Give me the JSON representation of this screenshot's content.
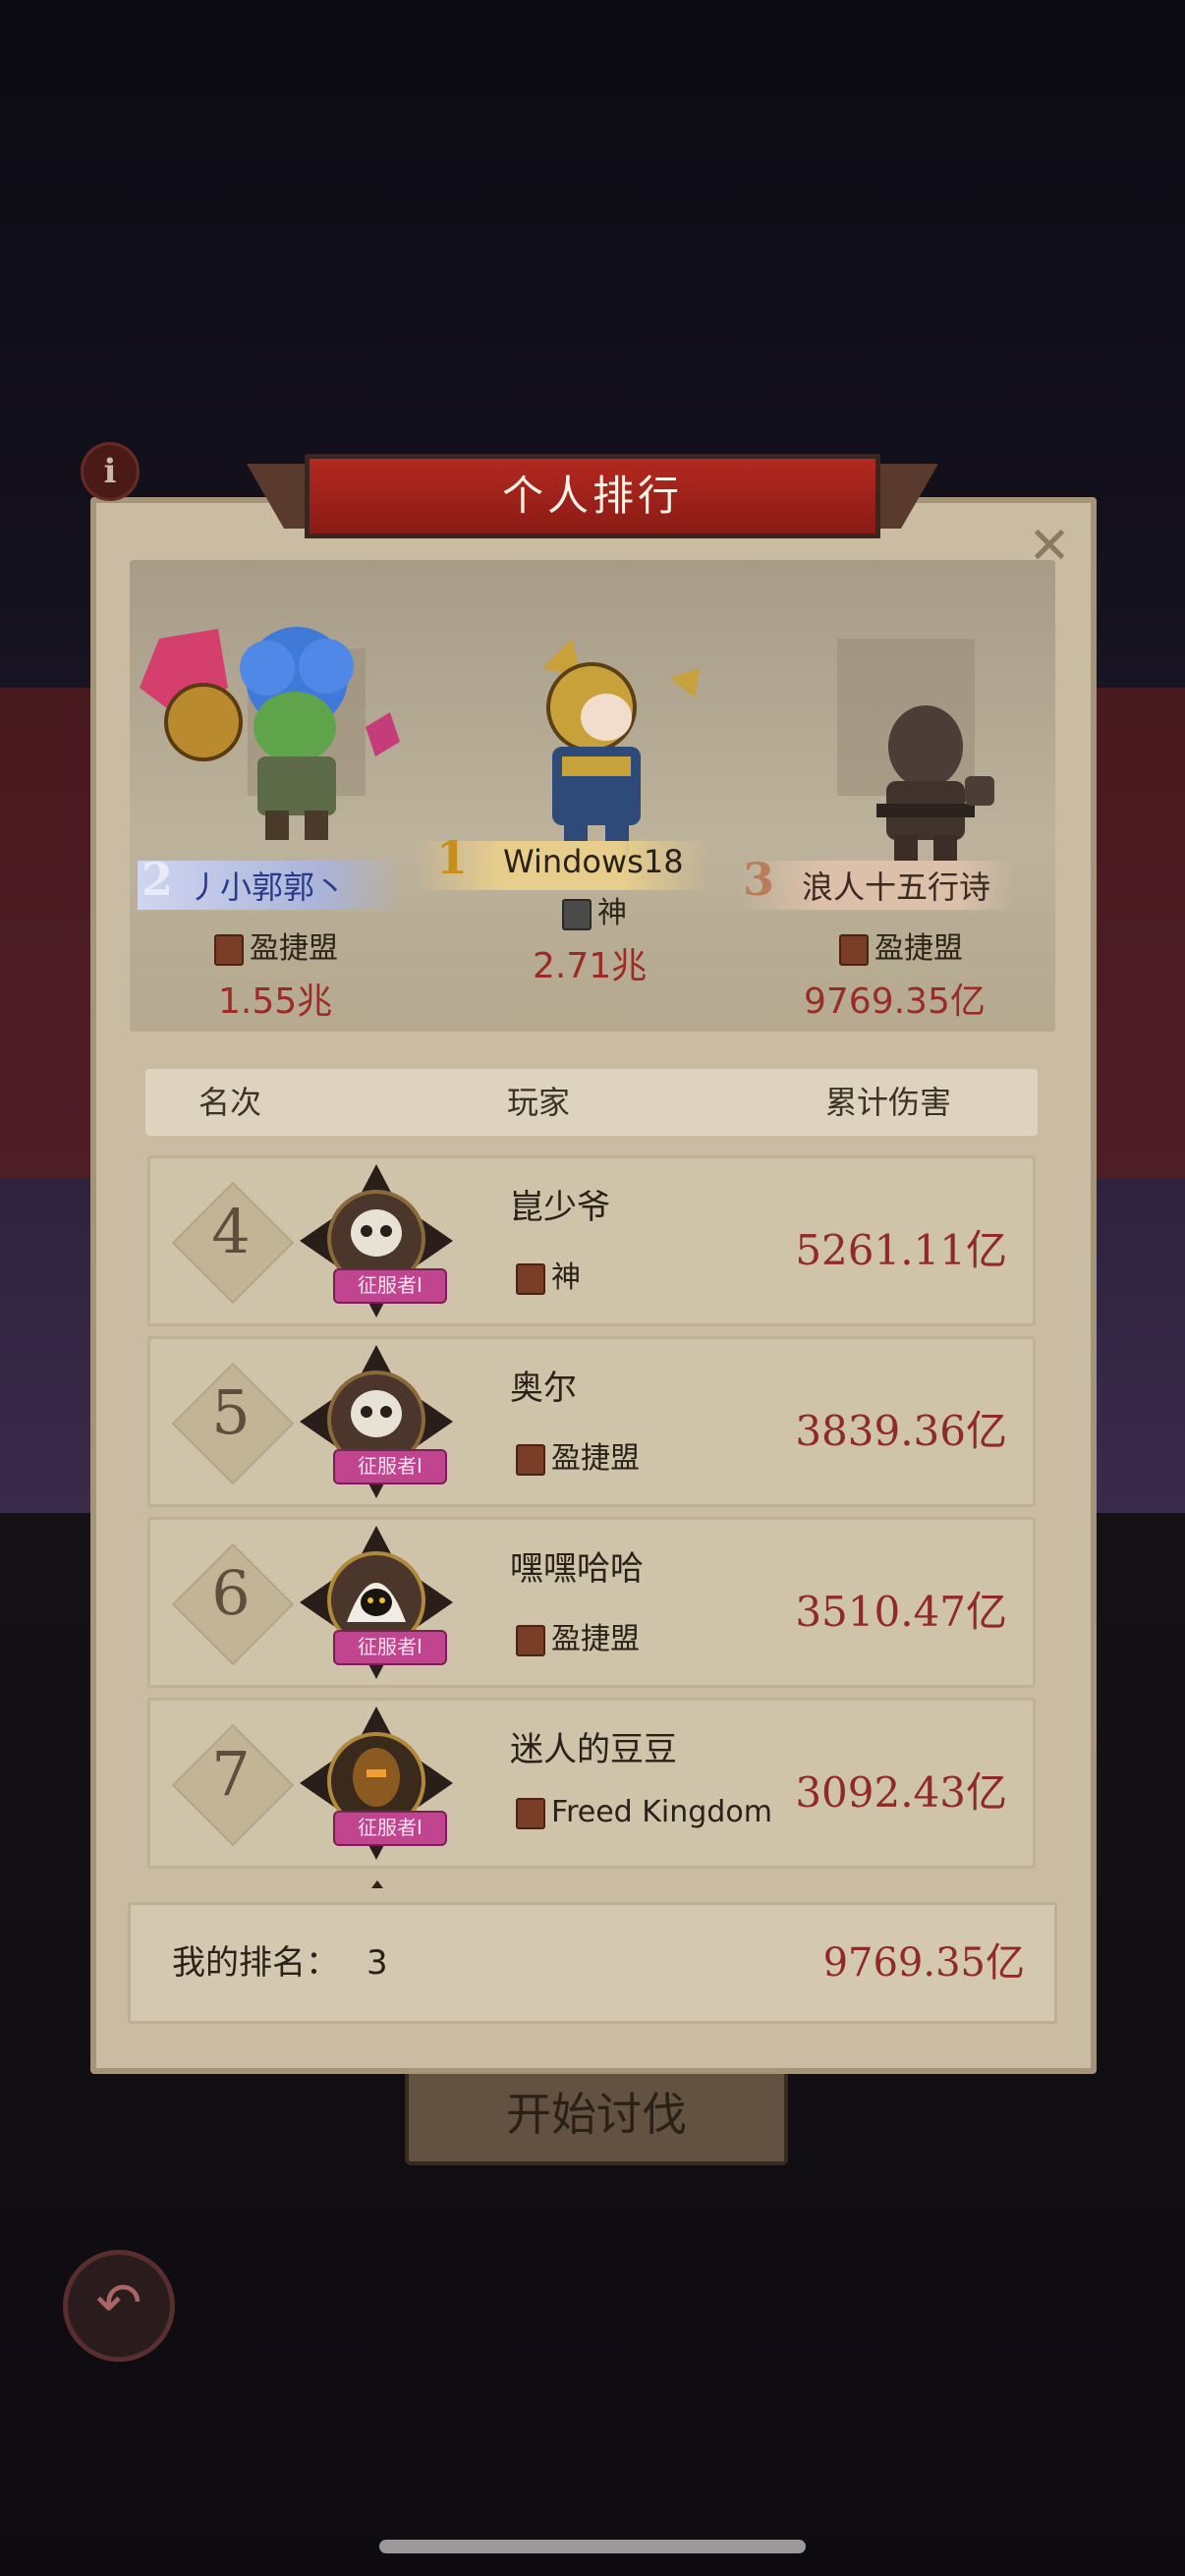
{
  "title": "个人排行",
  "info_icon": "i",
  "close_icon": "✕",
  "top3": [
    {
      "rank": "2",
      "name": "丿小郭郭丶",
      "guild": "盈捷盟",
      "damage": "1.55兆"
    },
    {
      "rank": "1",
      "name": "Windows18",
      "guild": "神",
      "damage": "2.71兆"
    },
    {
      "rank": "3",
      "name": "浪人十五行诗",
      "guild": "盈捷盟",
      "damage": "9769.35亿"
    }
  ],
  "table": {
    "col_rank": "名次",
    "col_player": "玩家",
    "col_damage": "累计伤害"
  },
  "rows": [
    {
      "rank": "4",
      "name": "崑少爷",
      "guild": "神",
      "damage": "5261.11亿",
      "tag": "征服者I"
    },
    {
      "rank": "5",
      "name": "奥尔",
      "guild": "盈捷盟",
      "damage": "3839.36亿",
      "tag": "征服者I"
    },
    {
      "rank": "6",
      "name": "嘿嘿哈哈",
      "guild": "盈捷盟",
      "damage": "3510.47亿",
      "tag": "征服者I"
    },
    {
      "rank": "7",
      "name": "迷人的豆豆",
      "guild": "Freed Kingdom",
      "damage": "3092.43亿",
      "tag": "征服者I"
    }
  ],
  "my_rank": {
    "label": "我的排名：",
    "value": "3",
    "damage": "9769.35亿"
  },
  "start_button": "开始讨伐",
  "back_icon": "↶",
  "colors": {
    "accent_red": "#8f2a27",
    "panel": "#c9bca2",
    "banner": "#b3291f",
    "tag": "#c0458e"
  }
}
